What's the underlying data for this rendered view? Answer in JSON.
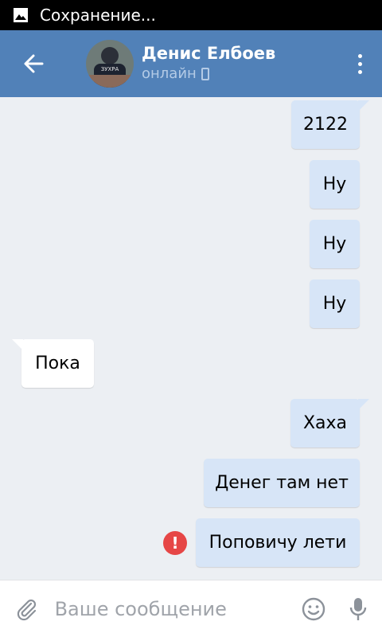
{
  "status_bar": {
    "text": "Сохранение..."
  },
  "header": {
    "name": "Денис Елбоев",
    "status": "онлайн",
    "avatar_shirt_text": "ЗУХРА"
  },
  "messages": [
    {
      "text": "2122",
      "direction": "out"
    },
    {
      "text": "Ну",
      "direction": "out"
    },
    {
      "text": "Ну",
      "direction": "out"
    },
    {
      "text": "Ну",
      "direction": "out"
    },
    {
      "text": "Пока",
      "direction": "in"
    },
    {
      "text": "Хаха",
      "direction": "out"
    },
    {
      "text": "Денег там нет",
      "direction": "out"
    },
    {
      "text": "Поповичу лети",
      "direction": "out",
      "failed": true
    }
  ],
  "composer": {
    "placeholder": "Ваше сообщение",
    "value": ""
  },
  "colors": {
    "header": "#5181b8",
    "outgoing": "#d7e5f7",
    "incoming": "#ffffff",
    "error": "#e64646",
    "background": "#eceff3"
  }
}
